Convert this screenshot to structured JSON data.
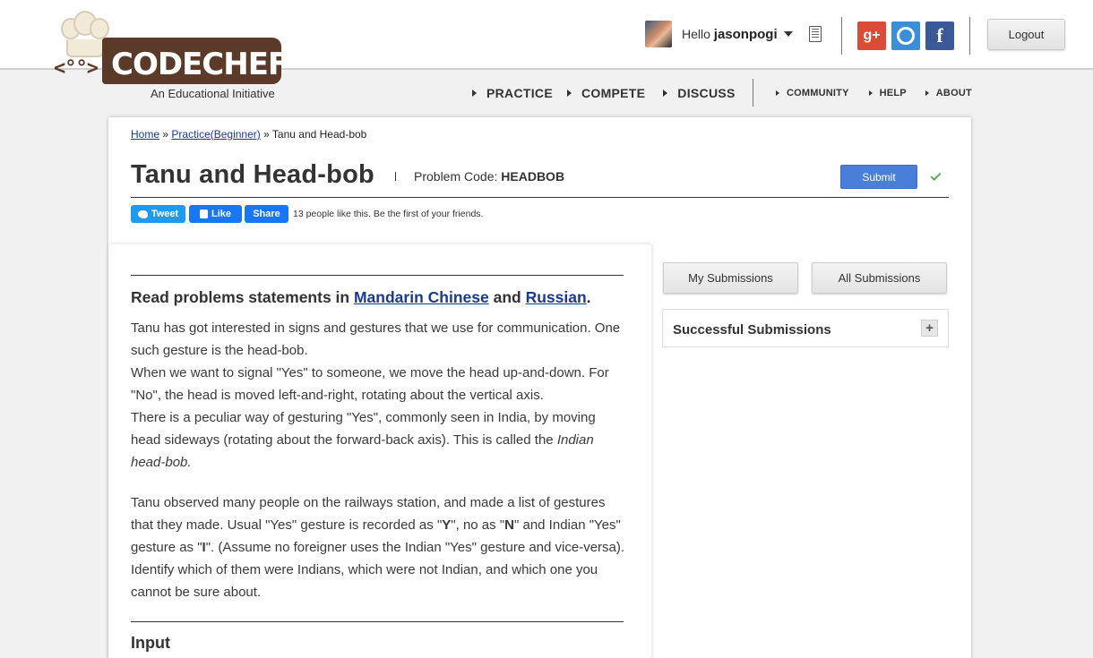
{
  "brand": {
    "name": "CODECHEF",
    "tagline": "An Educational Initiative"
  },
  "user": {
    "greeting": "Hello",
    "username": "jasonpogi"
  },
  "header": {
    "logout_label": "Logout",
    "social": {
      "gplus": "g+",
      "facebook": "f"
    }
  },
  "nav": {
    "main": [
      "PRACTICE",
      "COMPETE",
      "DISCUSS"
    ],
    "secondary": [
      "COMMUNITY",
      "HELP",
      "ABOUT"
    ]
  },
  "breadcrumb": {
    "home": "Home",
    "sep": "»",
    "section": "Practice(Beginner)",
    "current": "Tanu and Head-bob"
  },
  "problem": {
    "title": "Tanu and Head-bob",
    "code_label": "Problem Code:",
    "code": "HEADBOB",
    "submit_label": "Submit"
  },
  "share": {
    "tweet": "Tweet",
    "like": "Like",
    "share": "Share",
    "likes_text": "13 people like this. Be the first of your friends."
  },
  "statement": {
    "read_prefix": "Read problems statements in",
    "lang1": "Mandarin Chinese",
    "and": "and",
    "lang2": "Russian",
    "period": ".",
    "p1": "Tanu has got interested in signs and gestures that we use for communication. One such gesture is the head-bob.",
    "p2": "When we want to signal \"Yes\" to someone, we move the head up-and-down. For \"No\", the head is moved left-and-right, rotating about the vertical axis.",
    "p3a": "There is a peculiar way of gesturing \"Yes\", commonly seen in India, by moving head sideways (rotating about the forward-back axis). This is called the",
    "p3b": "Indian head-bob.",
    "p4a": "Tanu observed many people on the railways station, and made a list of gestures that they made. Usual \"Yes\" gesture is recorded as \"",
    "y": "Y",
    "p4b": "\", no as \"",
    "n": "N",
    "p4c": "\" and Indian \"Yes\" gesture as \"",
    "i": "I",
    "p4d": "\". (Assume no foreigner uses the Indian \"Yes\" gesture and vice-versa). Identify which of them were Indians, which were not Indian, and which one you cannot be sure about.",
    "input_heading": "Input"
  },
  "sidebar": {
    "my_submissions": "My Submissions",
    "all_submissions": "All Submissions",
    "successful_submissions": "Successful Submissions",
    "expand": "+"
  },
  "colors": {
    "brand_brown": "#5b3a29",
    "link": "#1a3a8f",
    "submit_blue": "#4a7fd9",
    "check_green": "#5aa85a"
  }
}
